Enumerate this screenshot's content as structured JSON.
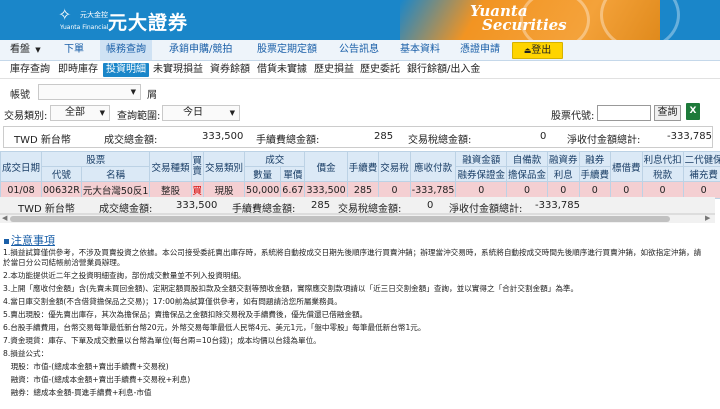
{
  "header": {
    "logo_cn_small": "元大金控",
    "logo_en_small": "Yuanta Financial",
    "logo_main": "元大證券",
    "brand_en_line1": "Yuanta",
    "brand_en_line2": "Securities"
  },
  "nav": {
    "items": [
      {
        "label": "看盤"
      },
      {
        "label": "下單"
      },
      {
        "label": "帳務查詢"
      },
      {
        "label": "承銷申購/競拍"
      },
      {
        "label": "股票定期定額"
      },
      {
        "label": "公告訊息"
      },
      {
        "label": "基本資料"
      },
      {
        "label": "憑證申請"
      }
    ],
    "logout_label": "登出"
  },
  "subnav": {
    "items": [
      "庫存查詢",
      "即時庫存",
      "投資明細",
      "未實現損益",
      "資券餘額",
      "借貨未實據",
      "歷史損益",
      "歷史委託",
      "銀行餘額/出入金"
    ]
  },
  "filters": {
    "account_label": "帳號",
    "account_suffix": "屑",
    "trade_type_label": "交易類別:",
    "trade_type_value": "全部",
    "range_label": "查詢範圍:",
    "range_value": "今日",
    "stock_code_label": "股票代號:",
    "query_button": "查詢"
  },
  "summary": {
    "currency": "TWD 新台幣",
    "deal_total_label": "成交總金額:",
    "deal_total_value": "333,500",
    "fee_total_label": "手續費總金額:",
    "fee_total_value": "285",
    "tax_total_label": "交易稅總金額:",
    "tax_total_value": "0",
    "net_total_label": "淨收付金額總計:",
    "net_total_value": "-333,785"
  },
  "table": {
    "header_row1": {
      "trade_date": "成交日期",
      "stock": "股票",
      "trade_kind": "交易種類",
      "buy_sell": "買賣",
      "trade_cat": "交易類別",
      "deal": "成交",
      "price": "價金",
      "fee": "手續費",
      "tax": "交易稅",
      "receivable": "應收付款",
      "margin_amt": "融資金額",
      "self_collateral": "自備款",
      "margin_int": "融資券",
      "fin_fee": "融券",
      "ticket_fee": "標借費",
      "interest": "利息代扣",
      "nhi": "二代健保",
      "last": "擔"
    },
    "header_row2": {
      "code": "代號",
      "name": "名稱",
      "qty": "數量",
      "unit_price": "單價",
      "margin_amt2": "融券保證金",
      "self_collateral2": "擔保品金",
      "margin_int2": "利息",
      "fin_fee2": "手續費",
      "interest2": "稅款",
      "nhi2": "補充費"
    },
    "rows": [
      {
        "date": "01/08",
        "code": "00632R",
        "name": "元大台灣50反1",
        "kind": "整股",
        "bs": "買",
        "cat": "現股",
        "qty": "50,000",
        "price": "6.67",
        "amount": "333,500",
        "fee": "285",
        "tax": "0",
        "receivable": "-333,785",
        "c1": "0",
        "c2": "0",
        "c3": "0",
        "c4": "0",
        "c5": "0",
        "c6": "0",
        "c7": "0"
      }
    ]
  },
  "total_row": {
    "currency": "TWD 新台幣",
    "deal_total_label": "成交總金額:",
    "deal_total_value": "333,500",
    "fee_total_label": "手續費總金額:",
    "fee_total_value": "285",
    "tax_total_label": "交易稅總金額:",
    "tax_total_value": "0",
    "net_total_label": "淨收付金額總計:",
    "net_total_value": "-333,785"
  },
  "notes": {
    "title": "注意事項",
    "lines": [
      "1.損益試算僅供參考，不涉及買賣投資之依據。本公司接受委託賣出庫存時，系統將自動按成交日期先後順序進行買賣沖銷；辦理當沖交易時，系統將自動按成交時間先後順序進行買賣沖銷，如欲指定沖銷，請",
      "於當日分公司結帳前洽營業員辦理。",
      "2.本功能提供近二年之投資明細查詢，部份成交數量並不列入投資明細。",
      "3.上開「應收付金額」含(先賣未買回金額)、定期定額買股扣款及全額交割等預收金額，實際應交割款項請以「近三日交割金額」查詢，並以實得之「合計交割金額」為準。",
      "4.當日庫交割金額(不含借貸擔保品之交易)；17:00前為試算僅供參考，如有問題請洽您所屬業務員。",
      "5.賣出現股：優先賣出庫存，其次為擔保品；賣擔保品之金額扣除交易稅及手續費後，優先償還已借融金額。",
      "6.台股手續費用，台幣交易每筆最低新台幣20元，外幣交易每筆最低人民幣4元、美元1元，「盤中零股」每筆最低新台幣1元。",
      "7.資金現貨：庫存、下單及成交數量以台幣為單位(每台兩=10台錢)；成本均價以台錢為單位。",
      "8.損益公式：",
      "　現股：市值-(總成本金額+賣出手續費+交易稅)",
      "　融資：市值-(總成本金額+賣出手續費+交易稅+利息)",
      "　融券：總成本金額-買進手續費+利息-市值"
    ]
  }
}
